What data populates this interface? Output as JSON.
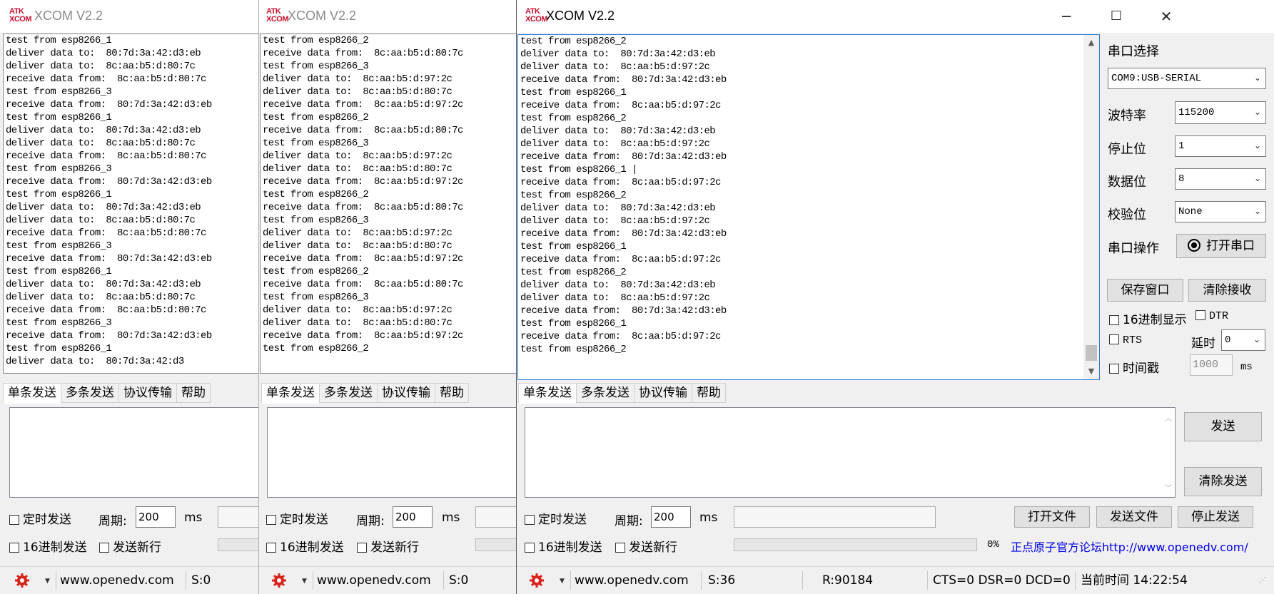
{
  "windows": [
    {
      "title": "XCOM V2.2",
      "logo": [
        "ATK",
        "XCOM"
      ],
      "receive_lines": [
        "test from esp8266_1",
        "deliver data to:  80:7d:3a:42:d3:eb",
        "deliver data to:  8c:aa:b5:d:80:7c",
        "receive data from:  8c:aa:b5:d:80:7c",
        "test from esp8266_3",
        "receive data from:  80:7d:3a:42:d3:eb",
        "test from esp8266_1",
        "deliver data to:  80:7d:3a:42:d3:eb",
        "deliver data to:  8c:aa:b5:d:80:7c",
        "receive data from:  8c:aa:b5:d:80:7c",
        "test from esp8266_3",
        "receive data from:  80:7d:3a:42:d3:eb",
        "test from esp8266_1",
        "deliver data to:  80:7d:3a:42:d3:eb",
        "deliver data to:  8c:aa:b5:d:80:7c",
        "receive data from:  8c:aa:b5:d:80:7c",
        "test from esp8266_3",
        "receive data from:  80:7d:3a:42:d3:eb",
        "test from esp8266_1",
        "deliver data to:  80:7d:3a:42:d3:eb",
        "deliver data to:  8c:aa:b5:d:80:7c",
        "receive data from:  8c:aa:b5:d:80:7c",
        "test from esp8266_3",
        "receive data from:  80:7d:3a:42:d3:eb",
        "test from esp8266_1",
        "deliver data to:  80:7d:3a:42:d3"
      ],
      "tabs": [
        "单条发送",
        "多条发送",
        "协议传输",
        "帮助"
      ],
      "timed_send": "定时发送",
      "period_label": "周期:",
      "period_value": "200",
      "ms": "ms",
      "hex_send": "16进制发送",
      "send_newline": "发送新行",
      "status_url": "www.openedv.com",
      "status_s": "S:0"
    },
    {
      "title": "XCOM V2.2",
      "logo": [
        "ATK",
        "XCOM"
      ],
      "receive_lines": [
        "test from esp8266_2",
        "receive data from:  8c:aa:b5:d:80:7c",
        "test from esp8266_3",
        "deliver data to:  8c:aa:b5:d:97:2c",
        "deliver data to:  8c:aa:b5:d:80:7c",
        "receive data from:  8c:aa:b5:d:97:2c",
        "test from esp8266_2",
        "receive data from:  8c:aa:b5:d:80:7c",
        "test from esp8266_3",
        "deliver data to:  8c:aa:b5:d:97:2c",
        "deliver data to:  8c:aa:b5:d:80:7c",
        "receive data from:  8c:aa:b5:d:97:2c",
        "test from esp8266_2",
        "receive data from:  8c:aa:b5:d:80:7c",
        "test from esp8266_3",
        "deliver data to:  8c:aa:b5:d:97:2c",
        "deliver data to:  8c:aa:b5:d:80:7c",
        "receive data from:  8c:aa:b5:d:97:2c",
        "test from esp8266_2",
        "receive data from:  8c:aa:b5:d:80:7c",
        "test from esp8266_3",
        "deliver data to:  8c:aa:b5:d:97:2c",
        "deliver data to:  8c:aa:b5:d:80:7c",
        "receive data from:  8c:aa:b5:d:97:2c",
        "test from esp8266_2"
      ],
      "tabs": [
        "单条发送",
        "多条发送",
        "协议传输",
        "帮助"
      ],
      "timed_send": "定时发送",
      "period_label": "周期:",
      "period_value": "200",
      "ms": "ms",
      "hex_send": "16进制发送",
      "send_newline": "发送新行",
      "status_url": "www.openedv.com",
      "status_s": "S:0"
    },
    {
      "title": "XCOM V2.2",
      "logo": [
        "ATK",
        "XCOM"
      ],
      "receive_lines": [
        "test from esp8266_2",
        "deliver data to:  80:7d:3a:42:d3:eb",
        "deliver data to:  8c:aa:b5:d:97:2c",
        "receive data from:  80:7d:3a:42:d3:eb",
        "test from esp8266_1",
        "receive data from:  8c:aa:b5:d:97:2c",
        "test from esp8266_2",
        "deliver data to:  80:7d:3a:42:d3:eb",
        "deliver data to:  8c:aa:b5:d:97:2c",
        "receive data from:  80:7d:3a:42:d3:eb",
        "test from esp8266_1 |",
        "receive data from:  8c:aa:b5:d:97:2c",
        "test from esp8266_2",
        "deliver data to:  80:7d:3a:42:d3:eb",
        "deliver data to:  8c:aa:b5:d:97:2c",
        "receive data from:  80:7d:3a:42:d3:eb",
        "test from esp8266_1",
        "receive data from:  8c:aa:b5:d:97:2c",
        "test from esp8266_2",
        "deliver data to:  80:7d:3a:42:d3:eb",
        "deliver data to:  8c:aa:b5:d:97:2c",
        "receive data from:  80:7d:3a:42:d3:eb",
        "test from esp8266_1",
        "receive data from:  8c:aa:b5:d:97:2c",
        "test from esp8266_2"
      ],
      "tabs": [
        "单条发送",
        "多条发送",
        "协议传输",
        "帮助"
      ],
      "timed_send": "定时发送",
      "period_label": "周期:",
      "period_value": "200",
      "ms": "ms",
      "hex_send": "16进制发送",
      "send_newline": "发送新行",
      "open_file": "打开文件",
      "send_file": "发送文件",
      "stop_send": "停止发送",
      "progress_pct": "0%",
      "forum_link": "正点原子官方论坛http://www.openedv.com/",
      "send_btn": "发送",
      "clear_send": "清除发送",
      "status_url": "www.openedv.com",
      "status_s": "S:36",
      "status_r": "R:90184",
      "status_lines": "CTS=0 DSR=0 DCD=0",
      "status_time": "当前时间 14:22:54",
      "panel": {
        "port_select_label": "串口选择",
        "port_value": "COM9:USB-SERIAL",
        "baud_label": "波特率",
        "baud_value": "115200",
        "stop_label": "停止位",
        "stop_value": "1",
        "data_label": "数据位",
        "data_value": "8",
        "parity_label": "校验位",
        "parity_value": "None",
        "op_label": "串口操作",
        "open_port": "打开串口",
        "save_window": "保存窗口",
        "clear_receive": "清除接收",
        "hex_display": "16进制显示",
        "dtr": "DTR",
        "rts": "RTS",
        "delay_label": "延时",
        "delay_value": "0",
        "timestamp": "时间戳",
        "timestamp_value": "1000",
        "ms": "ms"
      }
    }
  ]
}
